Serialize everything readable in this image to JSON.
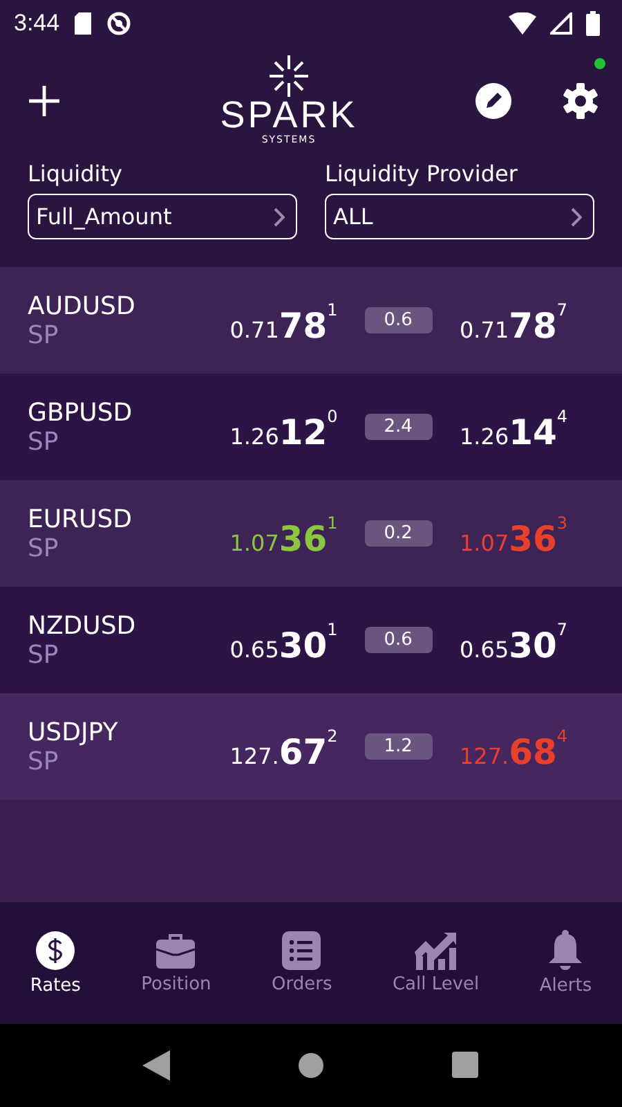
{
  "status_bar": {
    "time": "3:44"
  },
  "header": {
    "logo_title": "SPARK",
    "logo_subtitle": "SYSTEMS",
    "notification_dot": true
  },
  "filters": [
    {
      "label": "Liquidity",
      "value": "Full_Amount"
    },
    {
      "label": "Liquidity Provider",
      "value": "ALL"
    }
  ],
  "rates": [
    {
      "pair": "AUDUSD",
      "type": "SP",
      "bid": {
        "prefix": "0.71",
        "big": "78",
        "pip": "1",
        "color": "#ffffff"
      },
      "spread": "0.6",
      "ask": {
        "prefix": "0.71",
        "big": "78",
        "pip": "7",
        "color": "#ffffff"
      }
    },
    {
      "pair": "GBPUSD",
      "type": "SP",
      "bid": {
        "prefix": "1.26",
        "big": "12",
        "pip": "0",
        "color": "#ffffff"
      },
      "spread": "2.4",
      "ask": {
        "prefix": "1.26",
        "big": "14",
        "pip": "4",
        "color": "#ffffff"
      }
    },
    {
      "pair": "EURUSD",
      "type": "SP",
      "bid": {
        "prefix": "1.07",
        "big": "36",
        "pip": "1",
        "color": "#8cc63f"
      },
      "spread": "0.2",
      "ask": {
        "prefix": "1.07",
        "big": "36",
        "pip": "3",
        "color": "#e8402a"
      }
    },
    {
      "pair": "NZDUSD",
      "type": "SP",
      "bid": {
        "prefix": "0.65",
        "big": "30",
        "pip": "1",
        "color": "#ffffff"
      },
      "spread": "0.6",
      "ask": {
        "prefix": "0.65",
        "big": "30",
        "pip": "7",
        "color": "#ffffff"
      }
    },
    {
      "pair": "USDJPY",
      "type": "SP",
      "bid": {
        "prefix": "127.",
        "big": "67",
        "pip": "2",
        "color": "#ffffff"
      },
      "spread": "1.2",
      "ask": {
        "prefix": "127.",
        "big": "68",
        "pip": "4",
        "color": "#e8402a"
      }
    }
  ],
  "nav": [
    {
      "label": "Rates",
      "kind": "dollar",
      "selected": true
    },
    {
      "label": "Position",
      "kind": "briefcase",
      "selected": false
    },
    {
      "label": "Orders",
      "kind": "list",
      "selected": false
    },
    {
      "label": "Call Level",
      "kind": "chart",
      "selected": false
    },
    {
      "label": "Alerts",
      "kind": "bell",
      "selected": false
    }
  ]
}
